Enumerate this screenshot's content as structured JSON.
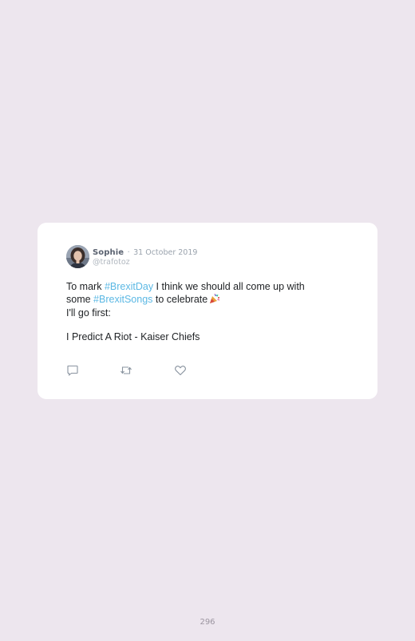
{
  "tweet": {
    "author_name": "Sophie",
    "separator": "·",
    "date": "31 October 2019",
    "handle": "@trafotoz",
    "lines": {
      "line1_pre": "To mark ",
      "line1_tag": "#BrexitDay",
      "line1_post": " I think we should all come up with",
      "line2_pre": "some ",
      "line2_tag": "#BrexitSongs",
      "line2_post": " to celebrate",
      "line3": "I'll go first:",
      "line4": "I Predict A Riot - Kaiser Chiefs"
    },
    "emoji": "party-popper-icon",
    "actions": [
      "reply-icon",
      "retweet-icon",
      "like-icon"
    ]
  },
  "page": {
    "number": "296"
  },
  "colors": {
    "background": "#ede6ee",
    "card": "#ffffff",
    "hashtag": "#5bb8e4",
    "icon": "#8a94a0"
  }
}
